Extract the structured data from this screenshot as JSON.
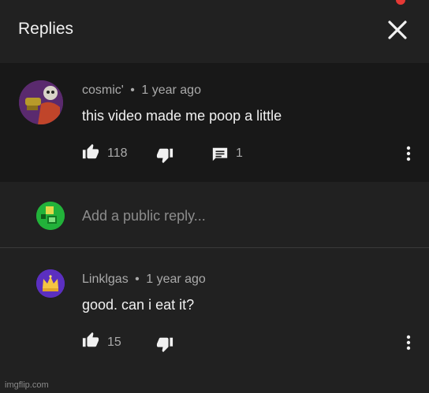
{
  "header": {
    "title": "Replies"
  },
  "parent_comment": {
    "author": "cosmic'",
    "separator": "•",
    "time": "1 year ago",
    "text": "this video made me poop a little",
    "likes": "118",
    "replies": "1"
  },
  "reply_box": {
    "placeholder": "Add a public reply..."
  },
  "reply_comment": {
    "author": "Linklgas",
    "separator": "•",
    "time": "1 year ago",
    "text": "good. can i eat it?",
    "likes": "15"
  },
  "watermark": "imgflip.com",
  "colors": {
    "background": "#212121",
    "parent_background": "#181818",
    "text": "#f1f1f1",
    "secondary_text": "#aaaaaa"
  },
  "icons": [
    "close-icon",
    "thumbs-up-icon",
    "thumbs-down-icon",
    "comment-icon",
    "more-vert-icon"
  ]
}
